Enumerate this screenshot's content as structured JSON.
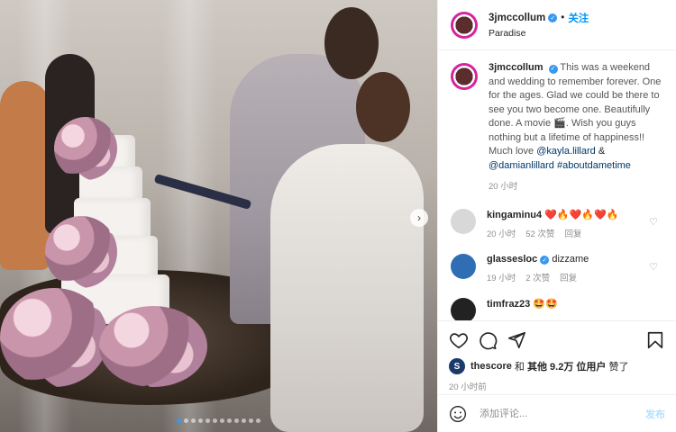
{
  "post": {
    "username": "3jmccollum",
    "follow_label": "关注",
    "dot": "•",
    "location": "Paradise"
  },
  "caption": {
    "username": "3jmccollum",
    "text": "This was a weekend and wedding to remember forever. One for the ages. Glad we could be there to see you two become one. Beautifully done. A movie 🎬. Wish you guys nothing but a lifetime of happiness!! Much love",
    "mention1": "@kayla.lillard",
    "amp": "&",
    "mention2": "@damianlillard",
    "hashtag": "#aboutdametime",
    "time": "20 小时"
  },
  "comments": [
    {
      "username": "kingaminu4",
      "text": "❤️🔥❤️🔥❤️🔥",
      "time": "20 小时",
      "likes": "52 次赞",
      "reply": "回复",
      "avatar_color": "#d8d8d8"
    },
    {
      "username": "glassesloc",
      "text": "dizzame",
      "time": "19 小时",
      "likes": "2 次赞",
      "reply": "回复",
      "avatar_color": "#2f6db5"
    },
    {
      "username": "timfraz23",
      "text": "🤩🤩",
      "time": "",
      "likes": "",
      "reply": "",
      "avatar_color": "#222222"
    }
  ],
  "likes": {
    "badge": "S",
    "username": "thescore",
    "and": "和",
    "others": "其他 9.2万 位用户",
    "suffix": "赞了"
  },
  "timestamp": "20 小时前",
  "add_comment": {
    "placeholder": "添加评论...",
    "post_label": "发布"
  },
  "carousel": {
    "total": 12,
    "active": 0,
    "next_glyph": "›"
  },
  "colors": {
    "accent": "#0095f6",
    "verified": "#3897f0",
    "muted": "#8e8e8e"
  },
  "icons": [
    "heart-icon",
    "comment-icon",
    "share-icon",
    "bookmark-icon",
    "emoji-icon",
    "verified-icon",
    "chevron-right-icon"
  ]
}
